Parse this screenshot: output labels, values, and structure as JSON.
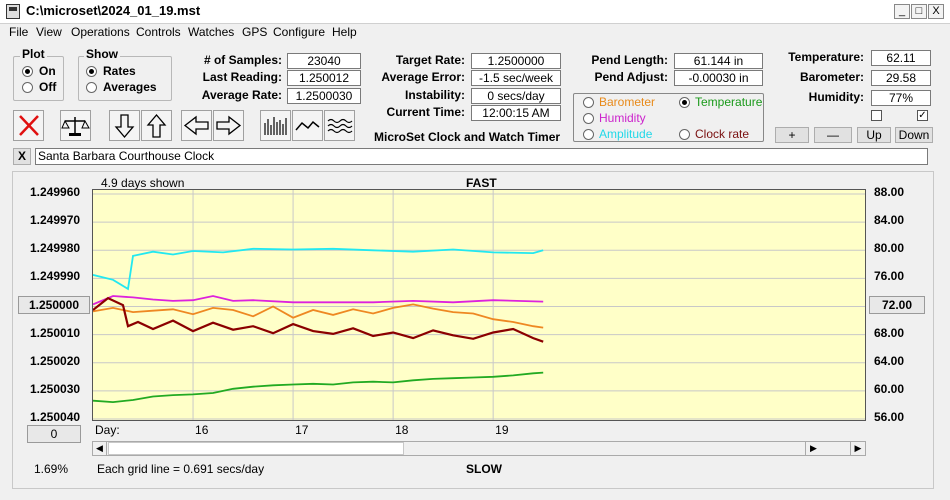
{
  "window": {
    "title": "C:\\microset\\2024_01_19.mst",
    "min_glyph": "_",
    "max_glyph": "□",
    "close_glyph": "X"
  },
  "menu": [
    "File",
    "View",
    "Operations",
    "Controls",
    "Watches",
    "GPS",
    "Configure",
    "Help"
  ],
  "plot_group": {
    "title": "Plot",
    "on": "On",
    "off": "Off"
  },
  "show_group": {
    "title": "Show",
    "rates": "Rates",
    "averages": "Averages"
  },
  "stats": {
    "samples_label": "# of Samples:",
    "samples": "23040",
    "last_label": "Last Reading:",
    "last": "1.250012",
    "avg_label": "Average Rate:",
    "avg": "1.2500030",
    "target_label": "Target Rate:",
    "target": "1.2500000",
    "err_label": "Average Error:",
    "err": "-1.5 sec/week",
    "inst_label": "Instability:",
    "inst": "0 secs/day",
    "time_label": "Current Time:",
    "time": "12:00:15 AM",
    "pendlen_label": "Pend Length:",
    "pendlen": "61.144 in",
    "pendadj_label": "Pend Adjust:",
    "pendadj": "-0.00030 in",
    "temp_label": "Temperature:",
    "temp": "62.11",
    "baro_label": "Barometer:",
    "baro": "29.58",
    "hum_label": "Humidity:",
    "hum": "77%"
  },
  "app_name": "MicroSet Clock and Watch Timer",
  "sensor_options": {
    "barometer": "Barometer",
    "temperature": "Temperature",
    "humidity": "Humidity",
    "amplitude": "Amplitude",
    "clock_rate": "Clock rate",
    "colors": {
      "barometer": "#e88a1a",
      "temperature": "#1a9a1a",
      "humidity": "#cc22cc",
      "amplitude": "#22d8e8",
      "clock_rate": "#7a1010"
    }
  },
  "right_buttons": {
    "plus": "+",
    "minus": "—",
    "up": "Up",
    "down": "Down",
    "chk2": "✓"
  },
  "clock_name": {
    "close": "X",
    "name": "Santa Barbara Courthouse Clock"
  },
  "chart_data": {
    "type": "line",
    "days_shown": "4.9 days shown",
    "top_label": "FAST",
    "bottom_label": "SLOW",
    "left_axis_ticks": [
      "1.249960",
      "1.249970",
      "1.249980",
      "1.249990",
      "1.250000",
      "1.250010",
      "1.250020",
      "1.250030",
      "1.250040"
    ],
    "left_center_button": "1.250000",
    "left_zero_button": "0",
    "right_axis_ticks": [
      "88.00",
      "84.00",
      "80.00",
      "76.00",
      "72.00",
      "68.00",
      "64.00",
      "60.00",
      "56.00"
    ],
    "right_center_button": "72.00",
    "day_label": "Day:",
    "day_ticks": [
      "16",
      "17",
      "18",
      "19"
    ],
    "grid_note": "Each grid line = 0.691 secs/day",
    "footer_left": "1.69%",
    "left_range": [
      1.24996,
      1.25004
    ],
    "right_range": [
      56,
      88
    ],
    "x_range": [
      15.0,
      20.0
    ],
    "series": [
      {
        "color": "#22e8f0",
        "axis": "right",
        "x": [
          15.0,
          15.2,
          15.35,
          15.4,
          15.6,
          15.8,
          16.0,
          16.3,
          16.6,
          17.0,
          17.4,
          17.8,
          18.2,
          18.6,
          19.0,
          19.4,
          19.5
        ],
        "y": [
          76.5,
          75.8,
          74.5,
          79.2,
          79.8,
          79.4,
          79.9,
          79.7,
          80.2,
          80.1,
          80.2,
          80.0,
          79.8,
          80.1,
          79.7,
          79.6,
          80.0
        ]
      },
      {
        "color": "#dd22dd",
        "axis": "right",
        "x": [
          15.0,
          15.2,
          15.4,
          15.6,
          15.8,
          16.0,
          16.2,
          16.4,
          16.6,
          17.0,
          17.4,
          17.8,
          18.2,
          18.6,
          19.0,
          19.5
        ],
        "y": [
          72.3,
          73.5,
          73.3,
          73.0,
          72.8,
          72.9,
          73.5,
          72.8,
          72.9,
          72.6,
          72.6,
          72.6,
          72.8,
          72.6,
          72.9,
          72.7
        ]
      },
      {
        "color": "#ee8822",
        "axis": "right",
        "x": [
          15.0,
          15.2,
          15.4,
          15.6,
          15.8,
          16.0,
          16.2,
          16.4,
          16.6,
          16.8,
          17.0,
          17.2,
          17.4,
          17.6,
          17.8,
          18.0,
          18.2,
          18.4,
          18.6,
          18.8,
          19.0,
          19.2,
          19.4,
          19.5
        ],
        "y": [
          71.3,
          71.8,
          71.2,
          71.4,
          71.6,
          70.9,
          71.8,
          71.5,
          70.6,
          72.0,
          70.4,
          71.5,
          70.8,
          71.6,
          71.0,
          71.8,
          72.3,
          71.7,
          71.2,
          71.0,
          70.2,
          69.8,
          69.2,
          69.0
        ]
      },
      {
        "color": "#8b0000",
        "axis": "right",
        "x": [
          15.0,
          15.15,
          15.3,
          15.35,
          15.45,
          15.6,
          15.8,
          16.0,
          16.2,
          16.4,
          16.6,
          16.8,
          17.0,
          17.2,
          17.4,
          17.6,
          17.8,
          18.0,
          18.2,
          18.4,
          18.6,
          18.8,
          19.0,
          19.2,
          19.4,
          19.5
        ],
        "y": [
          71.5,
          73.2,
          72.2,
          69.2,
          69.8,
          68.8,
          70.0,
          68.5,
          69.7,
          68.7,
          69.2,
          68.2,
          69.5,
          68.5,
          68.1,
          68.9,
          67.8,
          68.3,
          67.5,
          68.6,
          67.9,
          67.4,
          68.3,
          68.8,
          67.5,
          67.0
        ]
      },
      {
        "color": "#22aa22",
        "axis": "right",
        "x": [
          15.0,
          15.2,
          15.4,
          15.6,
          15.8,
          16.0,
          16.2,
          16.4,
          16.6,
          16.8,
          17.0,
          17.2,
          17.4,
          17.6,
          17.8,
          18.0,
          18.2,
          18.4,
          18.6,
          18.8,
          19.0,
          19.2,
          19.4,
          19.5
        ],
        "y": [
          58.6,
          58.4,
          58.7,
          59.2,
          59.4,
          59.5,
          59.7,
          60.3,
          60.6,
          60.8,
          60.9,
          61.0,
          60.9,
          61.2,
          61.3,
          61.2,
          61.5,
          61.7,
          61.8,
          61.9,
          62.0,
          62.2,
          62.5,
          62.6
        ]
      }
    ]
  }
}
